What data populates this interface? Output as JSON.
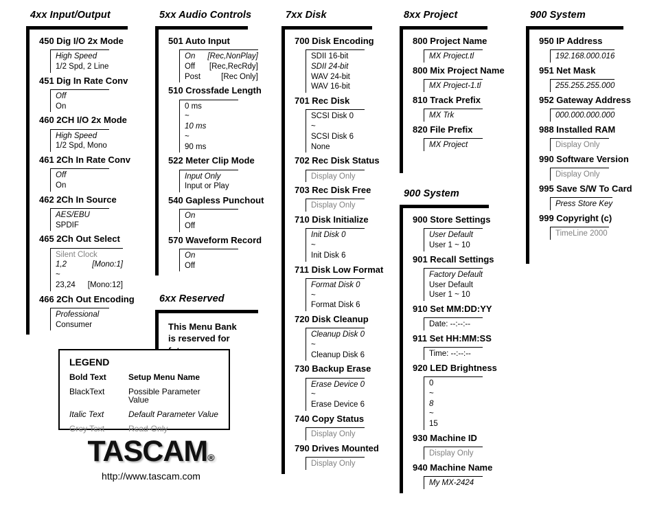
{
  "legend": {
    "title": "LEGEND",
    "rows": [
      {
        "key": "Bold Text",
        "desc": "Setup Menu Name"
      },
      {
        "key": "BlackText",
        "desc": "Possible Parameter Value"
      },
      {
        "key": "Italic Text",
        "desc": "Default Parameter Value"
      },
      {
        "key": "Grey Text",
        "desc": "Read-Only"
      }
    ]
  },
  "brand": {
    "logo": "TASCAM",
    "registered": "®",
    "url": "http://www.tascam.com"
  },
  "banks": [
    {
      "title": "4xx Input/Output",
      "entries": [
        {
          "name": "450 Dig I/O 2x Mode",
          "values": [
            {
              "text": "High Speed",
              "style": "default"
            },
            {
              "text": "1/2 Spd, 2 Line",
              "style": "normal"
            }
          ]
        },
        {
          "name": "451 Dig In Rate Conv",
          "values": [
            {
              "text": "Off",
              "style": "default"
            },
            {
              "text": "On",
              "style": "normal"
            }
          ]
        },
        {
          "name": "460 2CH I/O 2x Mode",
          "values": [
            {
              "text": "High Speed",
              "style": "default"
            },
            {
              "text": "1/2 Spd, Mono",
              "style": "normal"
            }
          ]
        },
        {
          "name": "461 2Ch In Rate Conv",
          "values": [
            {
              "text": "Off",
              "style": "default"
            },
            {
              "text": "On",
              "style": "normal"
            }
          ]
        },
        {
          "name": "462 2Ch In Source",
          "values": [
            {
              "text": "AES/EBU",
              "style": "default"
            },
            {
              "text": "SPDIF",
              "style": "normal"
            }
          ]
        },
        {
          "name": "465 2Ch Out Select",
          "values": [
            {
              "text": "Silent Clock",
              "style": "readonly"
            },
            {
              "left": "1,2",
              "right": "[Mono:1]",
              "style": "default"
            },
            {
              "text": "~",
              "style": "normal"
            },
            {
              "left": "23,24",
              "right": "[Mono:12]",
              "style": "normal"
            }
          ]
        },
        {
          "name": "466 2Ch Out Encoding",
          "values": [
            {
              "text": "Professional",
              "style": "default"
            },
            {
              "text": "Consumer",
              "style": "normal"
            }
          ]
        }
      ]
    },
    {
      "title": "5xx Audio Controls",
      "entries": [
        {
          "name": "501 Auto Input",
          "values": [
            {
              "left": "On",
              "right": "[Rec,NonPlay]",
              "style": "default"
            },
            {
              "left": "Off",
              "right": "[Rec,RecRdy]",
              "style": "normal"
            },
            {
              "left": "Post",
              "right": "[Rec Only]",
              "style": "normal"
            }
          ]
        },
        {
          "name": "510 Crossfade Length",
          "values": [
            {
              "text": "0 ms",
              "style": "normal"
            },
            {
              "text": "~",
              "style": "normal"
            },
            {
              "text": "10 ms",
              "style": "default"
            },
            {
              "text": "~",
              "style": "normal"
            },
            {
              "text": "90 ms",
              "style": "normal"
            }
          ]
        },
        {
          "name": "522 Meter Clip Mode",
          "values": [
            {
              "text": "Input Only",
              "style": "default"
            },
            {
              "text": "Input or Play",
              "style": "normal"
            }
          ]
        },
        {
          "name": "540 Gapless Punchout",
          "values": [
            {
              "text": "On",
              "style": "default"
            },
            {
              "text": "Off",
              "style": "normal"
            }
          ]
        },
        {
          "name": "570 Waveform Record",
          "values": [
            {
              "text": "On",
              "style": "default"
            },
            {
              "text": "Off",
              "style": "normal"
            }
          ]
        }
      ]
    },
    {
      "title": "6xx Reserved",
      "reserved_lines": [
        "This Menu Bank",
        "is reserved for",
        "future use"
      ],
      "entries": []
    },
    {
      "title": "7xx Disk",
      "entries": [
        {
          "name": "700 Disk Encoding",
          "values": [
            {
              "text": "SDII 16-bit",
              "style": "normal"
            },
            {
              "text": "SDII 24-bit",
              "style": "default"
            },
            {
              "text": "WAV 24-bit",
              "style": "normal"
            },
            {
              "text": "WAV 16-bit",
              "style": "normal"
            }
          ]
        },
        {
          "name": "701 Rec Disk",
          "values": [
            {
              "text": "SCSI Disk 0",
              "style": "normal"
            },
            {
              "text": "~",
              "style": "normal"
            },
            {
              "text": "SCSI Disk 6",
              "style": "normal"
            },
            {
              "text": "None",
              "style": "normal"
            }
          ]
        },
        {
          "name": "702 Rec Disk Status",
          "values": [
            {
              "text": "Display Only",
              "style": "readonly"
            }
          ]
        },
        {
          "name": "703 Rec Disk Free",
          "values": [
            {
              "text": "Display Only",
              "style": "readonly"
            }
          ]
        },
        {
          "name": "710 Disk Initialize",
          "values": [
            {
              "text": "Init Disk 0",
              "style": "default"
            },
            {
              "text": "~",
              "style": "normal"
            },
            {
              "text": "Init Disk 6",
              "style": "normal"
            }
          ]
        },
        {
          "name": "711 Disk Low Format",
          "values": [
            {
              "text": "Format Disk 0",
              "style": "default"
            },
            {
              "text": "~",
              "style": "normal"
            },
            {
              "text": "Format Disk 6",
              "style": "normal"
            }
          ]
        },
        {
          "name": "720 Disk Cleanup",
          "values": [
            {
              "text": "Cleanup Disk 0",
              "style": "default"
            },
            {
              "text": "~",
              "style": "normal"
            },
            {
              "text": "Cleanup Disk 6",
              "style": "normal"
            }
          ]
        },
        {
          "name": "730 Backup Erase",
          "values": [
            {
              "text": "Erase Device 0",
              "style": "default"
            },
            {
              "text": "~",
              "style": "normal"
            },
            {
              "text": "Erase Device 6",
              "style": "normal"
            }
          ]
        },
        {
          "name": "740 Copy Status",
          "values": [
            {
              "text": "Display Only",
              "style": "readonly"
            }
          ]
        },
        {
          "name": "790 Drives Mounted",
          "values": [
            {
              "text": "Display Only",
              "style": "readonly"
            }
          ]
        }
      ]
    },
    {
      "title": "8xx Project",
      "entries": [
        {
          "name": "800 Project Name",
          "values": [
            {
              "text": "MX Project.tl",
              "style": "default"
            }
          ]
        },
        {
          "name": "800 Mix Project Name",
          "values": [
            {
              "text": "MX Project-1.tl",
              "style": "default"
            }
          ]
        },
        {
          "name": "810 Track Prefix",
          "values": [
            {
              "text": "MX Trk",
              "style": "default"
            }
          ]
        },
        {
          "name": "820 File Prefix",
          "values": [
            {
              "text": "MX Project",
              "style": "default"
            }
          ]
        }
      ]
    },
    {
      "title": "900 System",
      "entries": [
        {
          "name": "900 Store Settings",
          "values": [
            {
              "text": "User Default",
              "style": "default"
            },
            {
              "text": "User 1 ~ 10",
              "style": "normal"
            }
          ]
        },
        {
          "name": "901 Recall Settings",
          "values": [
            {
              "text": "Factory Default",
              "style": "default"
            },
            {
              "text": "User Default",
              "style": "normal"
            },
            {
              "text": "User 1 ~ 10",
              "style": "normal"
            }
          ]
        },
        {
          "name": "910 Set   MM:DD:YY",
          "values": [
            {
              "text": "Date:   --:--:--",
              "style": "normal"
            }
          ]
        },
        {
          "name": "911 Set   HH:MM:SS",
          "values": [
            {
              "text": "Time:   --:--:--",
              "style": "normal"
            }
          ]
        },
        {
          "name": "920 LED Brightness",
          "values": [
            {
              "text": "0",
              "style": "normal"
            },
            {
              "text": "~",
              "style": "normal"
            },
            {
              "text": "8",
              "style": "default"
            },
            {
              "text": "~",
              "style": "normal"
            },
            {
              "text": "15",
              "style": "normal"
            }
          ]
        },
        {
          "name": "930 Machine ID",
          "values": [
            {
              "text": "Display Only",
              "style": "readonly"
            }
          ]
        },
        {
          "name": "940 Machine Name",
          "values": [
            {
              "text": "My MX-2424",
              "style": "default"
            }
          ]
        }
      ]
    },
    {
      "title": "900 System",
      "entries": [
        {
          "name": "950 IP Address",
          "values": [
            {
              "text": "192.168.000.016",
              "style": "default"
            }
          ]
        },
        {
          "name": "951 Net Mask",
          "values": [
            {
              "text": "255.255.255.000",
              "style": "default"
            }
          ]
        },
        {
          "name": "952 Gateway Address",
          "values": [
            {
              "text": "000.000.000.000",
              "style": "default"
            }
          ]
        },
        {
          "name": "988 Installed RAM",
          "values": [
            {
              "text": "Display Only",
              "style": "readonly"
            }
          ]
        },
        {
          "name": "990 Software Version",
          "values": [
            {
              "text": "Display Only",
              "style": "readonly"
            }
          ]
        },
        {
          "name": "995 Save S/W To Card",
          "values": [
            {
              "text": "Press Store Key",
              "style": "default"
            }
          ]
        },
        {
          "name": "999 Copyright (c)",
          "values": [
            {
              "text": "TimeLine 2000",
              "style": "readonly"
            }
          ]
        }
      ]
    }
  ]
}
